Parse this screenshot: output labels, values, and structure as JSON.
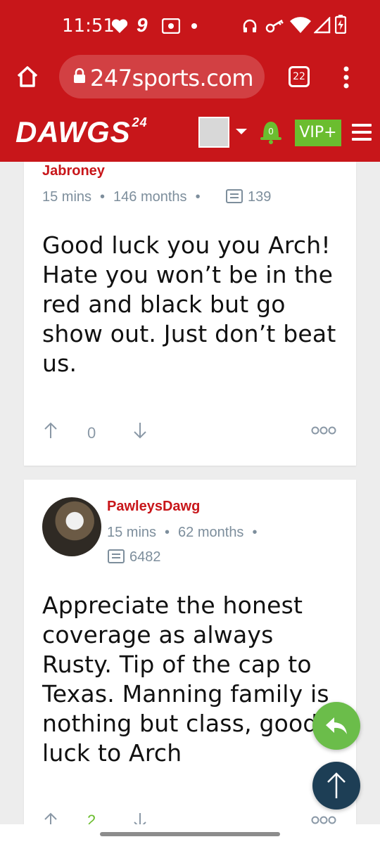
{
  "status_bar": {
    "time": "11:51",
    "icons": [
      "heart-icon",
      "nine-app-icon",
      "radio-icon",
      "dot-icon",
      "headset-icon",
      "key-icon",
      "wifi-icon",
      "signal-icon",
      "battery-charging-icon"
    ]
  },
  "browser": {
    "url": "247sports.com",
    "tab_count": "22",
    "home_icon": "home-icon",
    "lock_icon": "lock-icon",
    "menu_icon": "more-vert-icon"
  },
  "site_header": {
    "logo_text": "DAWGS",
    "logo_suffix": "24",
    "notification_count": "0",
    "vip_label": "VIP+"
  },
  "posts": [
    {
      "username": "Jabroney",
      "time_ago": "15 mins",
      "membership": "146 months",
      "post_count": "139",
      "body": "Good luck you you Arch! Hate you won’t be in the red and black but go show out. Just don’t beat us.",
      "vote_count": "0"
    },
    {
      "username": "PawleysDawg",
      "time_ago": "15 mins",
      "membership": "62 months",
      "post_count": "6482",
      "body": "Appreciate the honest coverage as always Rusty. Tip of the cap to Texas. Manning family is nothing but class, good luck to Arch",
      "vote_count": "2"
    }
  ],
  "colors": {
    "brand_red": "#c8161a",
    "vip_green": "#6bbd2f",
    "reply_green": "#6bbd4a",
    "scroll_top_navy": "#1d3e55",
    "meta_gray": "#7d8e9c"
  }
}
